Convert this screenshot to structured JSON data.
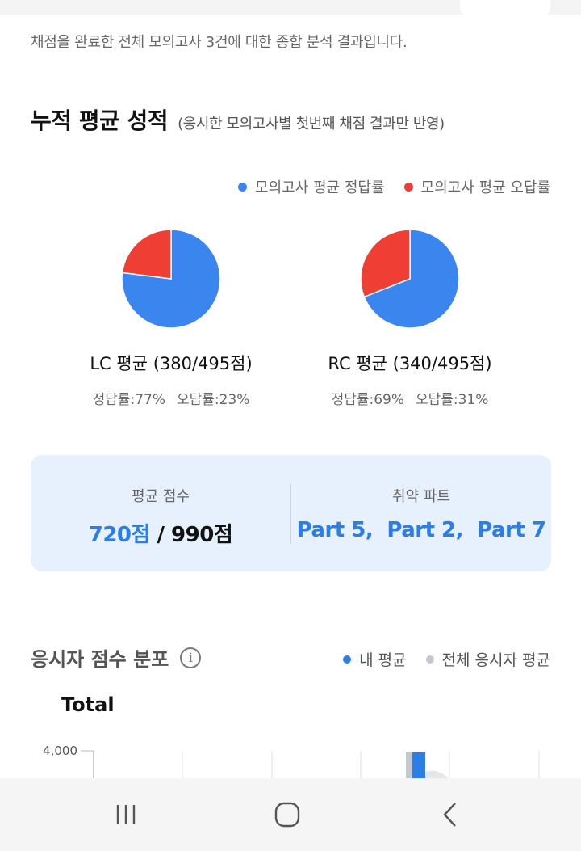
{
  "intro_text": "채점을 완료한 전체 모의고사 3건에 대한 종합 분석 결과입니다.",
  "section": {
    "title": "누적 평균 성적",
    "subtitle": "(응시한 모의고사별 첫번째 채점 결과만 반영)"
  },
  "legend": {
    "correct": "모의고사 평균 정답률",
    "wrong": "모의고사 평균 오답률"
  },
  "colors": {
    "correct": "#3a86ee",
    "wrong": "#ef3f35",
    "accent": "#2a7ee6",
    "overall": "#c4c8ce"
  },
  "pies": [
    {
      "label": "LC 평균 (380/495점)",
      "correct_label": "정답률:77%",
      "wrong_label": "오답률:23%",
      "correct_pct": 77
    },
    {
      "label": "RC 평균 (340/495점)",
      "correct_label": "정답률:69%",
      "wrong_label": "오답률:31%",
      "correct_pct": 69
    }
  ],
  "summary": {
    "avg_label": "평균 점수",
    "avg_score": "720점",
    "avg_sep": " / ",
    "avg_total": "990점",
    "weak_label": "취약 파트",
    "weak_parts": "Part 5,  Part 2,  Part 7"
  },
  "distribution": {
    "title": "응시자 점수 분포",
    "info_icon": "i",
    "legend_mine": "내 평균",
    "legend_all": "전체 응시자 평균",
    "chart_title": "Total",
    "y_tick": "4,000"
  },
  "navbar": {
    "recent_icon": "recent-apps-icon",
    "home_icon": "home-icon",
    "back_icon": "back-icon"
  }
}
